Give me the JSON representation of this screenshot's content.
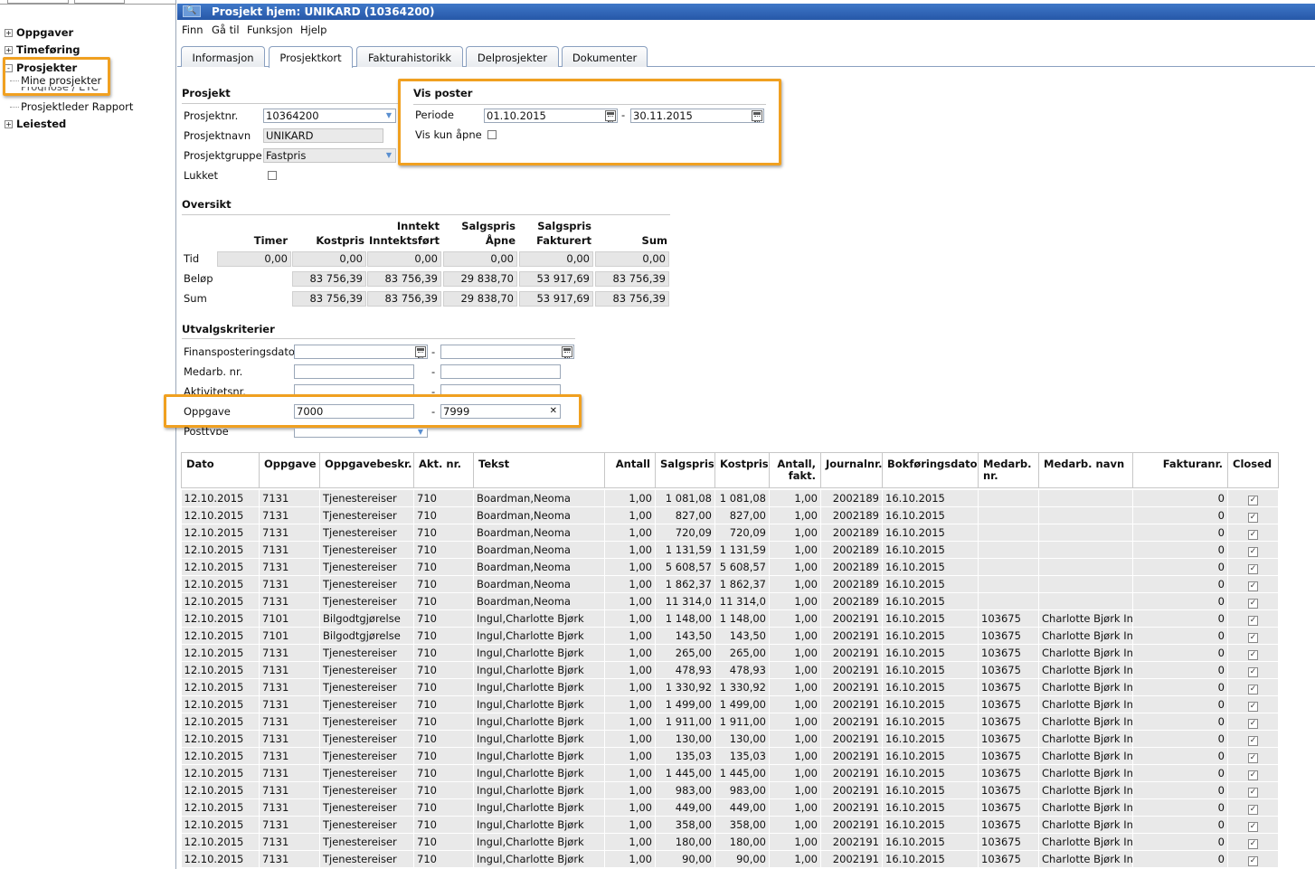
{
  "sidebar": {
    "items": [
      {
        "label": "Oppgaver",
        "toggle": "+"
      },
      {
        "label": "Timeføring",
        "toggle": "+"
      },
      {
        "label": "Prosjekter",
        "toggle": "-",
        "children": [
          "Mine prosjekter",
          "Prognose / ETC",
          "Prosjektleder Rapport"
        ]
      },
      {
        "label": "Leiested",
        "toggle": "+"
      }
    ]
  },
  "titlebar": {
    "title": "Prosjekt hjem: UNIKARD (10364200)"
  },
  "menu": [
    "Finn",
    "Gå til",
    "Funksjon",
    "Hjelp"
  ],
  "tabs": [
    "Informasjon",
    "Prosjektkort",
    "Fakturahistorikk",
    "Delprosjekter",
    "Dokumenter"
  ],
  "active_tab": "Prosjektkort",
  "prosjekt": {
    "heading": "Prosjekt",
    "nr_label": "Prosjektnr.",
    "nr": "10364200",
    "navn_label": "Prosjektnavn",
    "navn": "UNIKARD",
    "gruppe_label": "Prosjektgruppe",
    "gruppe": "Fastpris",
    "lukket_label": "Lukket"
  },
  "vis_poster": {
    "heading": "Vis poster",
    "periode_label": "Periode",
    "from": "01.10.2015",
    "sep": "-",
    "to": "30.11.2015",
    "kun_apne_label": "Vis kun åpne"
  },
  "oversikt": {
    "heading": "Oversikt",
    "columns": [
      {
        "line1": "",
        "line2": "Timer"
      },
      {
        "line1": "",
        "line2": "Kostpris"
      },
      {
        "line1": "Inntekt",
        "line2": "Inntektsført"
      },
      {
        "line1": "Salgspris",
        "line2": "Åpne"
      },
      {
        "line1": "Salgspris",
        "line2": "Fakturert"
      },
      {
        "line1": "",
        "line2": "Sum"
      }
    ],
    "rows": [
      {
        "label": "Tid",
        "values": [
          "0,00",
          "0,00",
          "0,00",
          "0,00",
          "0,00",
          "0,00"
        ]
      },
      {
        "label": "Beløp",
        "values": [
          "",
          "83 756,39",
          "83 756,39",
          "29 838,70",
          "53 917,69",
          "83 756,39"
        ]
      },
      {
        "label": "Sum",
        "values": [
          "",
          "83 756,39",
          "83 756,39",
          "29 838,70",
          "53 917,69",
          "83 756,39"
        ]
      }
    ]
  },
  "utvalg": {
    "heading": "Utvalgskriterier",
    "rows": [
      {
        "label": "Finansposteringsdato",
        "from": "",
        "to": ""
      },
      {
        "label": "Medarb. nr.",
        "from": "",
        "to": ""
      },
      {
        "label": "Aktivitetsnr.",
        "from": "",
        "to": ""
      },
      {
        "label": "Oppgave",
        "from": "7000",
        "to": "7999"
      },
      {
        "label": "Posttype",
        "from": ""
      }
    ],
    "sep": "-",
    "clear_glyph": "✕"
  },
  "grid": {
    "columns": [
      "Dato",
      "Oppgave",
      "Oppgavebeskr.",
      "Akt. nr.",
      "Tekst",
      "Antall",
      "Salgspris",
      "Kostpris",
      "Antall, fakt.",
      "Journalnr.",
      "Bokføringsdato",
      "Medarb. nr.",
      "Medarb. navn",
      "Fakturanr.",
      "Closed"
    ],
    "rows": [
      [
        "12.10.2015",
        "7131",
        "Tjenestereiser",
        "710",
        "Boardman,Neoma",
        "1,00",
        "1 081,08",
        "1 081,08",
        "1,00",
        "2002189",
        "16.10.2015",
        "",
        "",
        "0"
      ],
      [
        "12.10.2015",
        "7131",
        "Tjenestereiser",
        "710",
        "Boardman,Neoma",
        "1,00",
        "827,00",
        "827,00",
        "1,00",
        "2002189",
        "16.10.2015",
        "",
        "",
        "0"
      ],
      [
        "12.10.2015",
        "7131",
        "Tjenestereiser",
        "710",
        "Boardman,Neoma",
        "1,00",
        "720,09",
        "720,09",
        "1,00",
        "2002189",
        "16.10.2015",
        "",
        "",
        "0"
      ],
      [
        "12.10.2015",
        "7131",
        "Tjenestereiser",
        "710",
        "Boardman,Neoma",
        "1,00",
        "1 131,59",
        "1 131,59",
        "1,00",
        "2002189",
        "16.10.2015",
        "",
        "",
        "0"
      ],
      [
        "12.10.2015",
        "7131",
        "Tjenestereiser",
        "710",
        "Boardman,Neoma",
        "1,00",
        "5 608,57",
        "5 608,57",
        "1,00",
        "2002189",
        "16.10.2015",
        "",
        "",
        "0"
      ],
      [
        "12.10.2015",
        "7131",
        "Tjenestereiser",
        "710",
        "Boardman,Neoma",
        "1,00",
        "1 862,37",
        "1 862,37",
        "1,00",
        "2002189",
        "16.10.2015",
        "",
        "",
        "0"
      ],
      [
        "12.10.2015",
        "7131",
        "Tjenestereiser",
        "710",
        "Boardman,Neoma",
        "1,00",
        "11 314,0",
        "11 314,0",
        "1,00",
        "2002189",
        "16.10.2015",
        "",
        "",
        "0"
      ],
      [
        "12.10.2015",
        "7101",
        "Bilgodtgjørelse",
        "710",
        "Ingul,Charlotte Bjørk",
        "1,00",
        "1 148,00",
        "1 148,00",
        "1,00",
        "2002191",
        "16.10.2015",
        "103675",
        "Charlotte Bjørk In",
        "0"
      ],
      [
        "12.10.2015",
        "7101",
        "Bilgodtgjørelse",
        "710",
        "Ingul,Charlotte Bjørk",
        "1,00",
        "143,50",
        "143,50",
        "1,00",
        "2002191",
        "16.10.2015",
        "103675",
        "Charlotte Bjørk In",
        "0"
      ],
      [
        "12.10.2015",
        "7131",
        "Tjenestereiser",
        "710",
        "Ingul,Charlotte Bjørk",
        "1,00",
        "265,00",
        "265,00",
        "1,00",
        "2002191",
        "16.10.2015",
        "103675",
        "Charlotte Bjørk In",
        "0"
      ],
      [
        "12.10.2015",
        "7131",
        "Tjenestereiser",
        "710",
        "Ingul,Charlotte Bjørk",
        "1,00",
        "478,93",
        "478,93",
        "1,00",
        "2002191",
        "16.10.2015",
        "103675",
        "Charlotte Bjørk In",
        "0"
      ],
      [
        "12.10.2015",
        "7131",
        "Tjenestereiser",
        "710",
        "Ingul,Charlotte Bjørk",
        "1,00",
        "1 330,92",
        "1 330,92",
        "1,00",
        "2002191",
        "16.10.2015",
        "103675",
        "Charlotte Bjørk In",
        "0"
      ],
      [
        "12.10.2015",
        "7131",
        "Tjenestereiser",
        "710",
        "Ingul,Charlotte Bjørk",
        "1,00",
        "1 499,00",
        "1 499,00",
        "1,00",
        "2002191",
        "16.10.2015",
        "103675",
        "Charlotte Bjørk In",
        "0"
      ],
      [
        "12.10.2015",
        "7131",
        "Tjenestereiser",
        "710",
        "Ingul,Charlotte Bjørk",
        "1,00",
        "1 911,00",
        "1 911,00",
        "1,00",
        "2002191",
        "16.10.2015",
        "103675",
        "Charlotte Bjørk In",
        "0"
      ],
      [
        "12.10.2015",
        "7131",
        "Tjenestereiser",
        "710",
        "Ingul,Charlotte Bjørk",
        "1,00",
        "130,00",
        "130,00",
        "1,00",
        "2002191",
        "16.10.2015",
        "103675",
        "Charlotte Bjørk In",
        "0"
      ],
      [
        "12.10.2015",
        "7131",
        "Tjenestereiser",
        "710",
        "Ingul,Charlotte Bjørk",
        "1,00",
        "135,03",
        "135,03",
        "1,00",
        "2002191",
        "16.10.2015",
        "103675",
        "Charlotte Bjørk In",
        "0"
      ],
      [
        "12.10.2015",
        "7131",
        "Tjenestereiser",
        "710",
        "Ingul,Charlotte Bjørk",
        "1,00",
        "1 445,00",
        "1 445,00",
        "1,00",
        "2002191",
        "16.10.2015",
        "103675",
        "Charlotte Bjørk In",
        "0"
      ],
      [
        "12.10.2015",
        "7131",
        "Tjenestereiser",
        "710",
        "Ingul,Charlotte Bjørk",
        "1,00",
        "983,00",
        "983,00",
        "1,00",
        "2002191",
        "16.10.2015",
        "103675",
        "Charlotte Bjørk In",
        "0"
      ],
      [
        "12.10.2015",
        "7131",
        "Tjenestereiser",
        "710",
        "Ingul,Charlotte Bjørk",
        "1,00",
        "449,00",
        "449,00",
        "1,00",
        "2002191",
        "16.10.2015",
        "103675",
        "Charlotte Bjørk In",
        "0"
      ],
      [
        "12.10.2015",
        "7131",
        "Tjenestereiser",
        "710",
        "Ingul,Charlotte Bjørk",
        "1,00",
        "358,00",
        "358,00",
        "1,00",
        "2002191",
        "16.10.2015",
        "103675",
        "Charlotte Bjørk In",
        "0"
      ],
      [
        "12.10.2015",
        "7131",
        "Tjenestereiser",
        "710",
        "Ingul,Charlotte Bjørk",
        "1,00",
        "180,00",
        "180,00",
        "1,00",
        "2002191",
        "16.10.2015",
        "103675",
        "Charlotte Bjørk In",
        "0"
      ],
      [
        "12.10.2015",
        "7131",
        "Tjenestereiser",
        "710",
        "Ingul,Charlotte Bjørk",
        "1,00",
        "90,00",
        "90,00",
        "1,00",
        "2002191",
        "16.10.2015",
        "103675",
        "Charlotte Bjørk In",
        "0"
      ]
    ],
    "closed_glyph": "✓"
  },
  "colors": {
    "titlebar": "#2a5fb0",
    "highlight": "#f0a020"
  }
}
